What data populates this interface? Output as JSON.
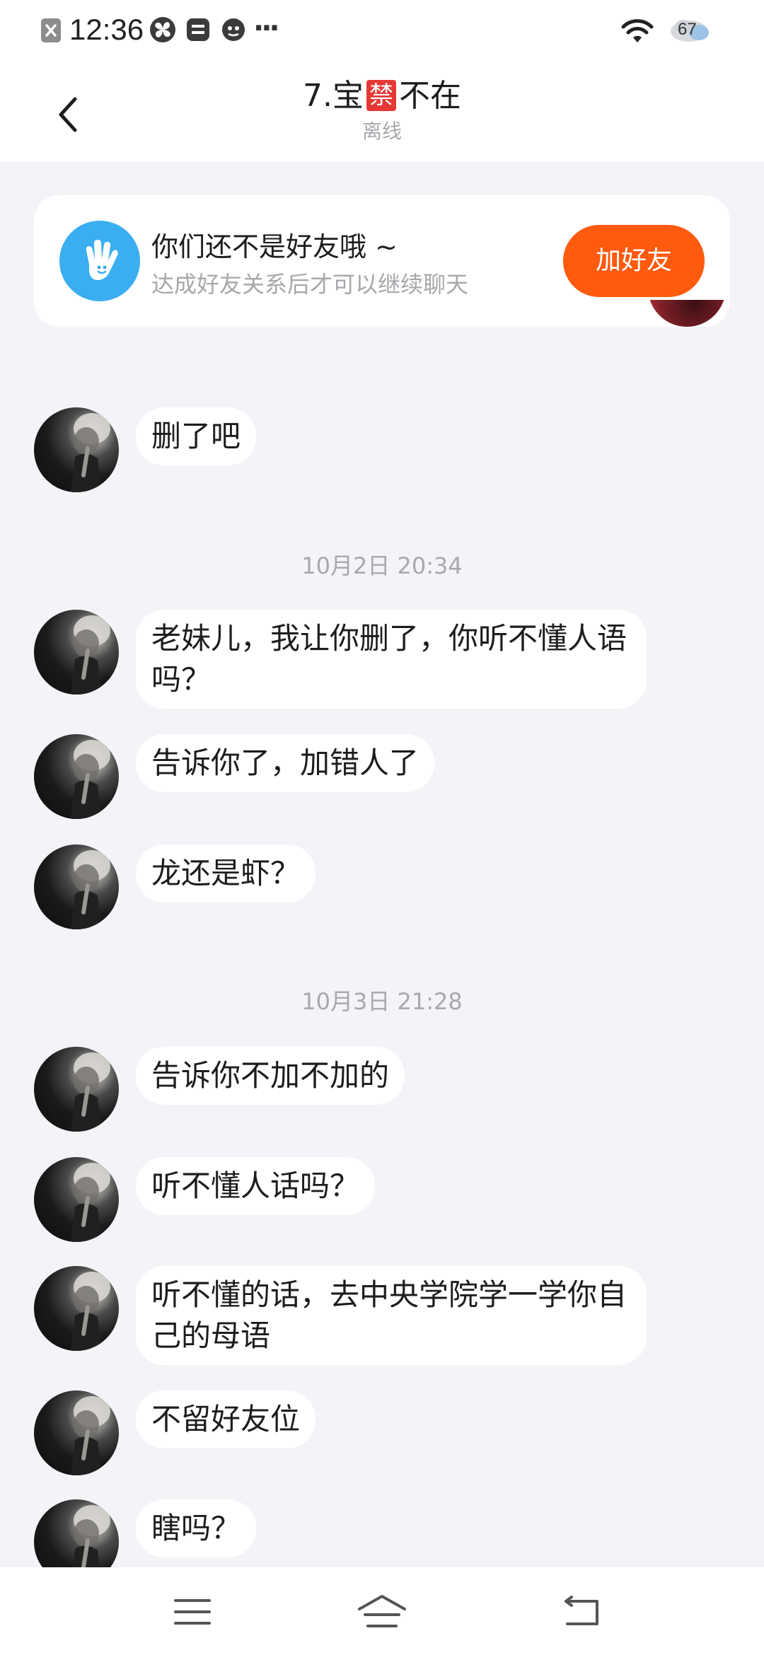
{
  "status_bar": {
    "time": "12:36",
    "battery": "67",
    "more_glyph": "···"
  },
  "header": {
    "title_prefix": "7.宝",
    "title_badge": "禁",
    "title_suffix": "不在",
    "subtitle": "离线"
  },
  "friend_card": {
    "title": "你们还不是好友哦 ~",
    "subtitle": "达成好友关系后才可以继续聊天",
    "button_label": "加好友"
  },
  "timestamps": {
    "t1": "10月2日 20:34",
    "t2": "10月3日 21:28"
  },
  "messages": [
    {
      "text": "删了吧"
    },
    {
      "text": "老妹儿，我让你删了，你听不懂人语吗？"
    },
    {
      "text": "告诉你了，加错人了"
    },
    {
      "text": "龙还是虾？"
    },
    {
      "text": "告诉你不加不加的"
    },
    {
      "text": "听不懂人话吗？"
    },
    {
      "text": "听不懂的话，去中央学院学一学你自己的母语"
    },
    {
      "text": "不留好友位"
    },
    {
      "text": "瞎吗？"
    }
  ],
  "colors": {
    "accent": "#ff5a0e",
    "badge": "#e53935",
    "card_icon_bg": "#3aaef0",
    "page_bg": "#f2f4f7"
  },
  "icons": {
    "back": "chevron-left-icon",
    "friend": "waving-hand-icon",
    "nav_menu": "menu-icon",
    "nav_home": "home-icon",
    "nav_back": "return-icon"
  }
}
